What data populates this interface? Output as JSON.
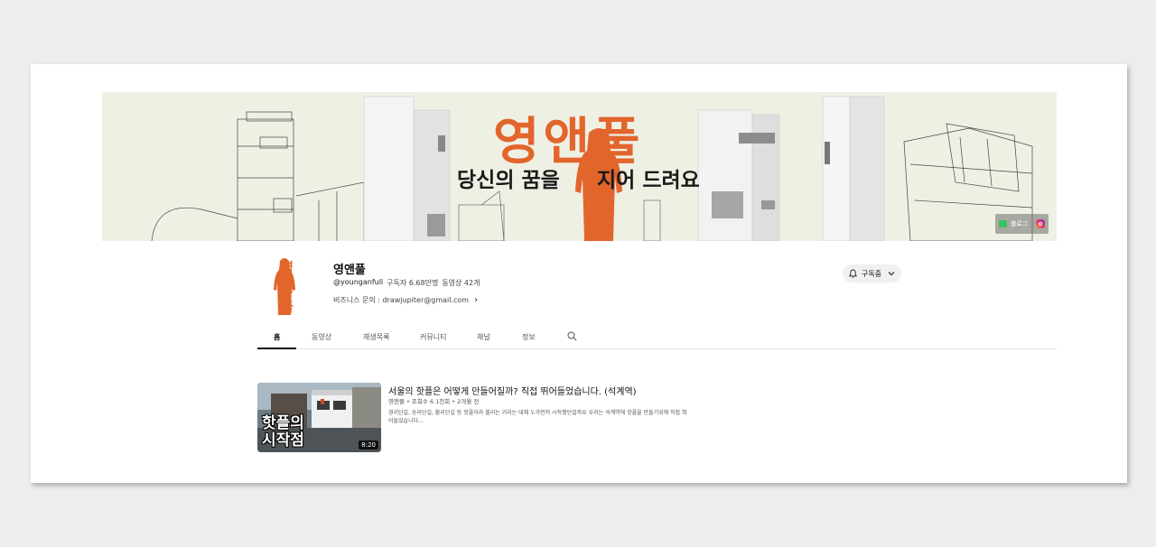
{
  "banner": {
    "title": "영앤풀",
    "tagline_left": "당신의 꿈을",
    "tagline_right": "지어 드려요",
    "blog_label": "블로그"
  },
  "channel": {
    "name": "영앤풀",
    "handle": "@younganfull",
    "subscribers": "구독자 6.68만명",
    "video_count": "동영상 42개",
    "business_contact": "비즈니스 문의 : drawjupiter@gmail.com",
    "subscribe_label": "구독중"
  },
  "tabs": [
    "홈",
    "동영상",
    "재생목록",
    "커뮤니티",
    "채널",
    "정보"
  ],
  "featured_video": {
    "title": "서울의 핫플은 어떻게 만들어질까? 직접 뛰어들었습니다. (석계역)",
    "meta": "영앤풀 • 조회수 6.1천회 • 2개월 전",
    "description": "경리단길, 송리단길, 황리단길 등 핫플이라 불리는 거리는 대체 누가먼저 시작했던걸까요 우리는 석계역에 핫플을 만들기위해 직접 뛰어들었습니다...",
    "thumb_line1": "핫플의",
    "thumb_line2": "시작점",
    "duration": "8:20"
  },
  "colors": {
    "brand_orange": "#e2652c",
    "banner_bg": "#eff0e4"
  },
  "icons": {
    "bell": "bell-icon",
    "chevron": "chevron-down-icon",
    "search": "search-icon",
    "blog": "naver-blog-icon",
    "instagram": "instagram-icon"
  }
}
